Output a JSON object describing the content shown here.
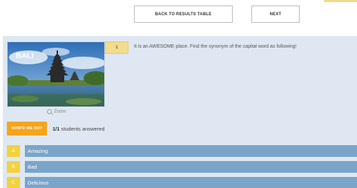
{
  "nav": {
    "back_label": "BACK TO RESULTS TABLE",
    "next_label": "NEXT"
  },
  "question": {
    "number": "1",
    "text": "It is an AWESOME place. Find the synonym of the capital word as following!",
    "image_caption": "BALI",
    "zoom_label": "Zoom"
  },
  "stats": {
    "howd_label": "HOW'D WE DO?",
    "answered_count": "1/1",
    "answered_label": "students answered"
  },
  "options": [
    {
      "letter": "A",
      "label": "Amazing"
    },
    {
      "letter": "B",
      "label": "Bad"
    },
    {
      "letter": "C",
      "label": "Delicious"
    }
  ],
  "colors": {
    "panel_bg": "#dfe8f2",
    "option_bar": "#7aa5c9",
    "option_letter": "#f3d23a",
    "howd_button": "#f5a41d",
    "question_number_bg": "#f3dc8e"
  }
}
